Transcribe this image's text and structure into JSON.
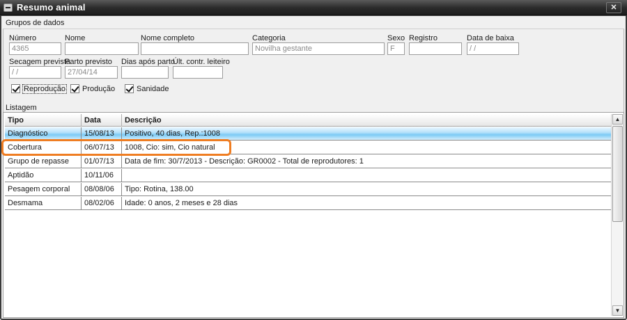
{
  "window": {
    "title": "Resumo animal",
    "close_label": "✕"
  },
  "groups": {
    "title": "Grupos de dados",
    "fields": {
      "numero": {
        "label": "Número",
        "value": "4365"
      },
      "nome": {
        "label": "Nome",
        "value": ""
      },
      "nome_completo": {
        "label": "Nome completo",
        "value": ""
      },
      "categoria": {
        "label": "Categoria",
        "value": "Novilha gestante"
      },
      "sexo": {
        "label": "Sexo",
        "value": "F"
      },
      "registro": {
        "label": "Registro",
        "value": ""
      },
      "data_baixa": {
        "label": "Data de baixa",
        "value": " /  /"
      },
      "secagem": {
        "label": "Secagem prevista",
        "value": " /  /"
      },
      "parto": {
        "label": "Parto previsto",
        "value": "27/04/14"
      },
      "dias_apos_parto": {
        "label": "Dias após parto",
        "value": ""
      },
      "ult_contr": {
        "label": "Últ. contr. leiteiro",
        "value": ""
      }
    },
    "checks": {
      "reproducao": {
        "label": "Reprodução",
        "checked": true
      },
      "producao": {
        "label": "Produção",
        "checked": true
      },
      "sanidade": {
        "label": "Sanidade",
        "checked": true
      }
    }
  },
  "listagem": {
    "title": "Listagem",
    "columns": {
      "tipo": "Tipo",
      "data": "Data",
      "descricao": "Descrição"
    },
    "rows": [
      {
        "tipo": "Diagnóstico",
        "data": "15/08/13",
        "descricao": "Positivo, 40 dias, Rep.:1008"
      },
      {
        "tipo": "Cobertura",
        "data": "06/07/13",
        "descricao": "1008, Cio: sim, Cio natural"
      },
      {
        "tipo": "Grupo de repasse",
        "data": "01/07/13",
        "descricao": "Data de fim: 30/7/2013 - Descrição: GR0002 - Total de reprodutores: 1"
      },
      {
        "tipo": "Aptidão",
        "data": "10/11/06",
        "descricao": ""
      },
      {
        "tipo": "Pesagem corporal",
        "data": "08/08/06",
        "descricao": "Tipo: Rotina, 138.00"
      },
      {
        "tipo": "Desmama",
        "data": "08/02/06",
        "descricao": "Idade: 0 anos, 2 meses e 28 dias"
      }
    ],
    "selected_row": 0,
    "highlighted_row": 1
  },
  "scrollbar": {
    "up": "▲",
    "down": "▼"
  },
  "colors": {
    "highlight": "#ef7d22",
    "selection": "#7ccaf5",
    "titlebar": "#2a2a2a"
  }
}
